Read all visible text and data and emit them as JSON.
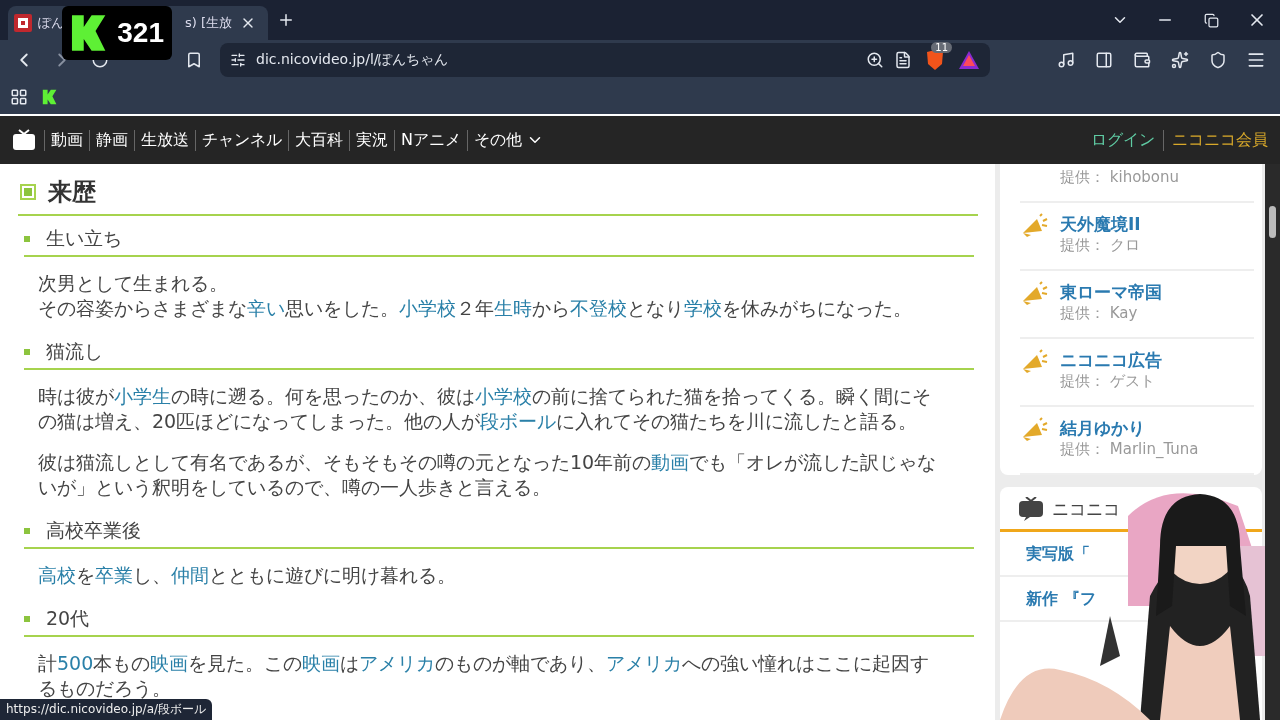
{
  "overlay_badge": {
    "count": "321"
  },
  "browser": {
    "tab": {
      "title_start": "ぽん",
      "title_end": "s) [生放",
      "selected": true
    },
    "url": "dic.nicovideo.jp/l/ぽんちゃん",
    "shield_count": "11"
  },
  "site_nav": {
    "items": [
      "動画",
      "静画",
      "生放送",
      "チャンネル",
      "大百科",
      "実況",
      "Nアニメ"
    ],
    "more": "その他",
    "login": "ログイン",
    "premium": "ニコニコ会員"
  },
  "article": {
    "heading": "来歴",
    "sections": [
      {
        "heading": "生い立ち",
        "paragraphs": [
          [
            [
              {
                "text": "次男として生まれる。",
                "link": false
              }
            ],
            [
              {
                "text": "その容姿からさまざまな",
                "link": false
              },
              {
                "text": "辛い",
                "link": true
              },
              {
                "text": "思いをした。",
                "link": false
              },
              {
                "text": "小学校",
                "link": true
              },
              {
                "text": "２年",
                "link": false
              },
              {
                "text": "生時",
                "link": true
              },
              {
                "text": "から",
                "link": false
              },
              {
                "text": "不登校",
                "link": true
              },
              {
                "text": "となり",
                "link": false
              },
              {
                "text": "学校",
                "link": true
              },
              {
                "text": "を休みがちになった。",
                "link": false
              }
            ]
          ]
        ]
      },
      {
        "heading": "猫流し",
        "paragraphs": [
          [
            [
              {
                "text": "時は彼が",
                "link": false
              },
              {
                "text": "小学生",
                "link": true
              },
              {
                "text": "の時に遡る。何を思ったのか、彼は",
                "link": false
              },
              {
                "text": "小学校",
                "link": true
              },
              {
                "text": "の前に捨てられた猫を拾ってくる。瞬く間にその猫は増え、20匹ほどになってしまった。他の人が",
                "link": false
              },
              {
                "text": "段ボール",
                "link": true
              },
              {
                "text": "に入れてその猫たちを川に流したと語る。",
                "link": false
              }
            ]
          ],
          [
            [
              {
                "text": "彼は猫流しとして有名であるが、そもそもその噂の元となった10年前の",
                "link": false
              },
              {
                "text": "動画",
                "link": true
              },
              {
                "text": "でも「オレが流した訳じゃないが」という釈明をしているので、噂の一人歩きと言える。",
                "link": false
              }
            ]
          ]
        ]
      },
      {
        "heading": "高校卒業後",
        "paragraphs": [
          [
            [
              {
                "text": "高校",
                "link": true
              },
              {
                "text": "を",
                "link": false
              },
              {
                "text": "卒業",
                "link": true
              },
              {
                "text": "し、",
                "link": false
              },
              {
                "text": "仲間",
                "link": true
              },
              {
                "text": "とともに遊びに明け暮れる。",
                "link": false
              }
            ]
          ]
        ]
      },
      {
        "heading": "20代",
        "paragraphs": [
          [
            [
              {
                "text": "計",
                "link": false
              },
              {
                "text": "500",
                "link": true
              },
              {
                "text": "本もの",
                "link": false
              },
              {
                "text": "映画",
                "link": true
              },
              {
                "text": "を見た。この",
                "link": false
              },
              {
                "text": "映画",
                "link": true
              },
              {
                "text": "は",
                "link": false
              },
              {
                "text": "アメリカ",
                "link": true
              },
              {
                "text": "のものが軸であり、",
                "link": false
              },
              {
                "text": "アメリカ",
                "link": true
              },
              {
                "text": "への強い憧れはここに起因するものだろう。",
                "link": false
              }
            ]
          ]
        ]
      }
    ]
  },
  "sidebar": {
    "ads": [
      {
        "provider_label": "提供：",
        "provider": "kihobonu"
      },
      {
        "title": "天外魔境II",
        "provider_label": "提供：",
        "provider": "クロ"
      },
      {
        "title": "東ローマ帝国",
        "provider_label": "提供：",
        "provider": "Kay"
      },
      {
        "title": "ニコニコ広告",
        "provider_label": "提供：",
        "provider": "ゲスト"
      },
      {
        "title": "結月ゆかり",
        "provider_label": "提供：",
        "provider": "Marlin_Tuna"
      }
    ],
    "news": {
      "heading": "ニコニコ",
      "items": [
        "実写版「",
        "新作 『フ"
      ]
    }
  },
  "status_url": "https://dic.nicovideo.jp/a/段ボール"
}
